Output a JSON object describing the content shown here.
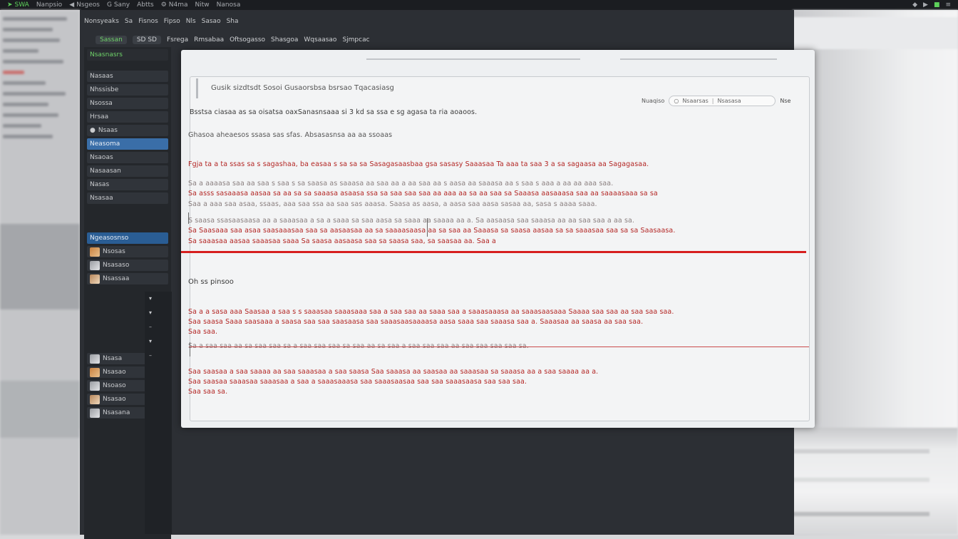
{
  "topbar": {
    "items": [
      "Nanpsio",
      "Nsgeos",
      "G Sany",
      "Abtts",
      "N4ma",
      "Nitw",
      "Nanosa"
    ],
    "green_item": "SWA"
  },
  "menubar": {
    "items": [
      "Nonsyeaks",
      "Sa",
      "Fisnos",
      "Fipso",
      "Nls",
      "Sasao",
      "Sha"
    ]
  },
  "toolbar": {
    "green_item": "Sassan",
    "pill_item": "SD SD",
    "items": [
      "Fsrega",
      "Rmsabaa",
      "Oftsogasso",
      "Shasgoa",
      "Wqsaasao",
      "Sjmpcac"
    ]
  },
  "panel": {
    "header": "Nsasnasrs",
    "rows": [
      "Nasaas",
      "Nhssisbe",
      "Nsossa",
      "Hrsaa",
      "Nsaas",
      "Neasoma",
      "Nsaoas",
      "Nasaasan",
      "Nasas",
      "Nsasaa"
    ],
    "section": "Ngeasosnso",
    "thumb_items": [
      "Nsosas",
      "Nsasaso",
      "Nsassaa"
    ],
    "thumb_items2": [
      "Nsasa",
      "Nsasao",
      "Nsoaso",
      "Nsasao",
      "Nsasana"
    ]
  },
  "dialog": {
    "title": "Gusik sizdtsdt Sosoi Gusaorsbsa bsrsao Tqacasiasg",
    "search_label": "Nuaqiso",
    "search_value": "Nsaarsas",
    "search_alt": "Nsasasa",
    "go_label": "Nse",
    "line1": "Bsstsa ciasaa as sa oisatsa oaxSanasnsaaa si 3 kd sa ssa e sg agasa ta ria aoaoos.",
    "line2": "Ghasoa aheaesos ssasa sas sfas. Absasasnsa aa aa ssoaas",
    "red1": "Fgja ta a ta ssas sa s sagashaa, ba easaa s sa sa sa Sasagasaasbaa gsa sasasy Saaasaa Ta aaa ta saa 3 a sa sagaasa aa Sagagasaa.",
    "faint1": "Sa a aaaasa saa aa saa s saa s sa saasa as saaasa aa saa aa a aa saa aa s aasa aa saaasa aa s saa s aaa a aa aa aaa saa.",
    "red2": "Sa asss sasaaasa aasaa sa aa sa sa saaasa asaasa ssa sa saa saa saa aa aaa aa sa aa saa sa Saaasa aasaaasa saa aa saaaasaaa sa sa",
    "faint2": "Saa a aaa saa asaa, ssaas, aaa saa ssa aa saa sas aaasa. Saasa as aasa, a aasa saa aasa sasaa aa, sasa s aaaa saaa.",
    "faint3": "S saasa ssasaasaasa aa a saaasaa a sa a saaa sa saa aasa sa saaa aa saaaa aa a. Sa aasaasa saa saaasa aa aa saa saa a aa sa.",
    "red3": "Sa Saasaaa saa asaa saasaaasaa saa sa aasaasaa aa sa saaaasaasa aa sa saa aa Saaasa sa saasa aasaa sa sa saaasaa saa sa sa Saasaasa.",
    "red4": "Sa saaasaa aasaa saaasaa saaa Sa saasa aasaasa saa sa saasa saa, sa saasaa aa. Saa a",
    "section_heading": "Oh ss pinsoo",
    "red5": "Sa a a sasa aaa Saasaa a saa s s saaasaa saaasaaa saa a saa saa aa saaa saa a saaasaaasa aa saaasaasaaa Saaaa saa saa aa saa saa saa.",
    "red6": "Saa saasa Saaa saasaaa a saasa saa saa saasaasa saa saaasaasaaaasa aasa saaa saa saaasa saa a. Saaasaa aa saasa aa saa saa.",
    "red7": "Saa saa.",
    "faint4": "Sa a saa saa aa sa saa saa sa a saa saa saa sa saa aa sa saa a saa saa saa aa saa saa saa saa sa.",
    "red8": "Saa saasaa a saa saaaa aa saa saaasaa a saa saasa Saa saaasa aa saasaa aa saaasaa sa saaasa aa a saa saaaa aa a.",
    "red9": "Saa saasaa saaasaa saaasaa a saa a saaasaaasa saa saaasaasaa saa saa saaasaasa saa saa saa.",
    "red10": "Saa saa sa."
  },
  "colors": {
    "accent_red": "#d61f1f",
    "selection_blue": "#3a6ea8",
    "green": "#5ed15b"
  }
}
